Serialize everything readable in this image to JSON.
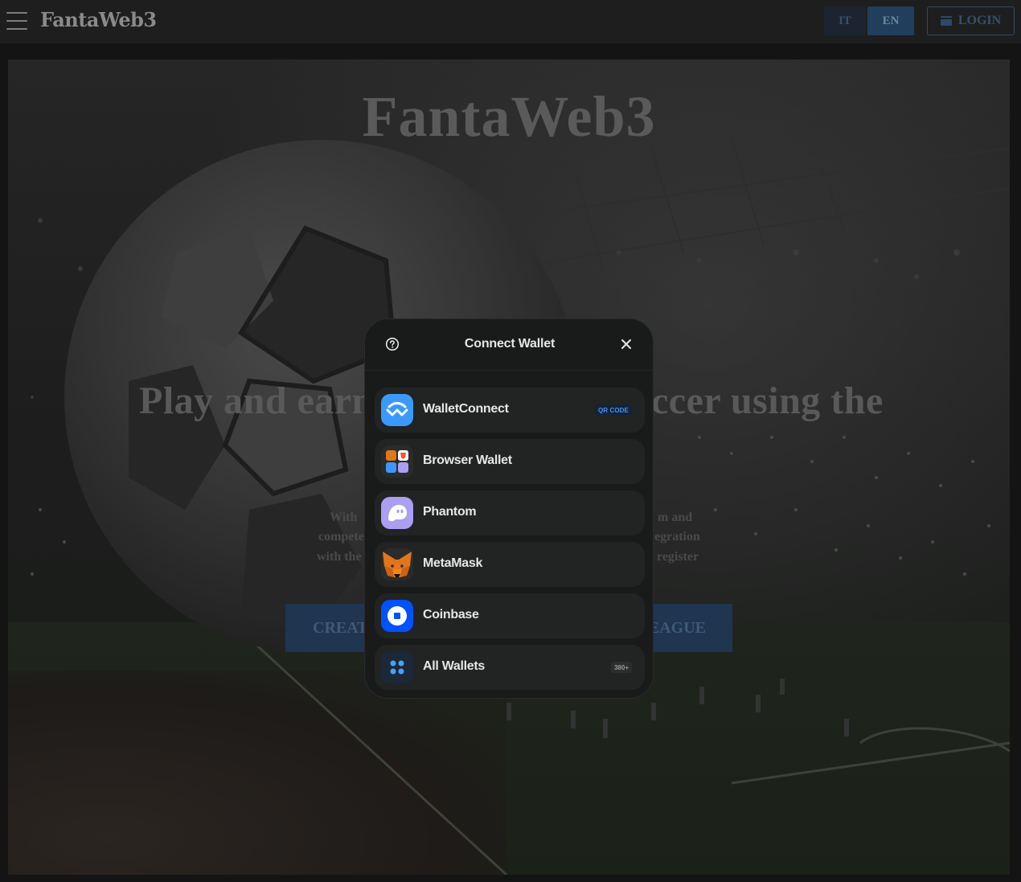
{
  "navbar": {
    "brand": "FantaWeb3",
    "lang_it": "IT",
    "lang_en": "EN",
    "login": "LOGIN"
  },
  "hero": {
    "title": "FantaWeb3",
    "headline_left": "Play and earn",
    "headline_right": "ccer using the",
    "desc_lines": [
      {
        "left": "With",
        "right": "m and"
      },
      {
        "left": "compete",
        "right": "egration"
      },
      {
        "left": "with the",
        "right": "register"
      }
    ],
    "cta_create": "CREAT",
    "cta_join": "EAGUE"
  },
  "modal": {
    "title": "Connect Wallet",
    "wallets": [
      {
        "name": "WalletConnect",
        "badge": "QR CODE",
        "icon": "walletconnect-icon",
        "color": "#3b99fc"
      },
      {
        "name": "Browser Wallet",
        "icon": "browser-wallet-icon"
      },
      {
        "name": "Phantom",
        "icon": "phantom-icon",
        "color": "#ab9ff2"
      },
      {
        "name": "MetaMask",
        "icon": "metamask-icon",
        "color": "#e2761b"
      },
      {
        "name": "Coinbase",
        "icon": "coinbase-icon",
        "color": "#0052ff"
      },
      {
        "name": "All Wallets",
        "badge": "380+",
        "icon": "grid-icon",
        "color": "#47a1ff"
      }
    ]
  }
}
